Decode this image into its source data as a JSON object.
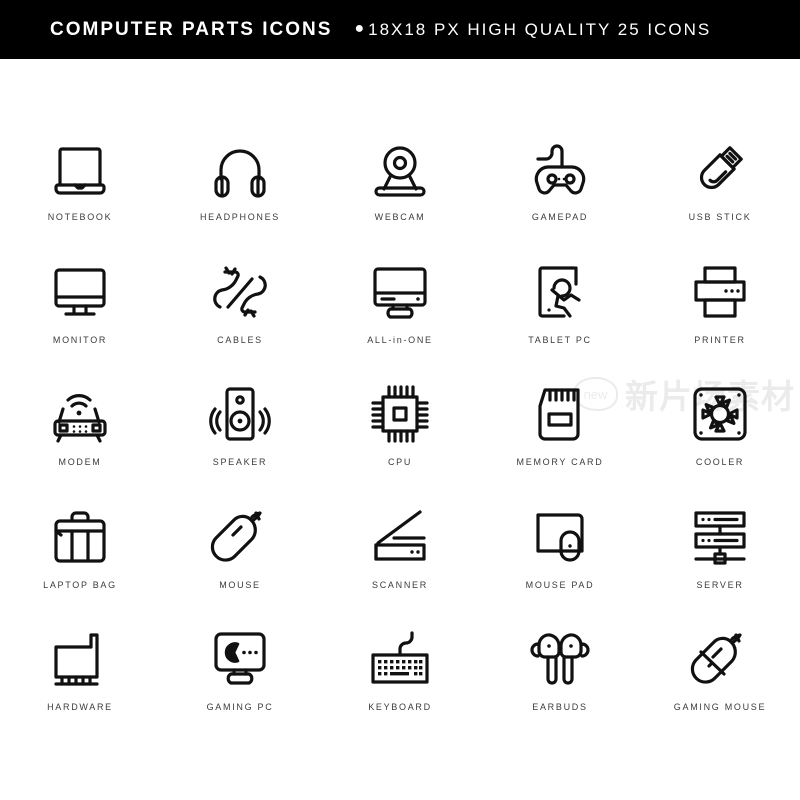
{
  "header": {
    "title": "COMPUTER PARTS ICONS",
    "bullet": "●",
    "subtitle": "18X18 PX HIGH QUALITY 25 ICONS",
    "background": "#000000",
    "text_color": "#ffffff"
  },
  "watermark": {
    "badge_text": "new",
    "chinese_text": "新片场素材",
    "color": "#777777"
  },
  "grid": {
    "columns": 5,
    "rows": 5,
    "icon_stroke_color": "#111111",
    "label_color": "#3b3b3b",
    "items": [
      {
        "label": "NOTEBOOK",
        "icon": "notebook-icon"
      },
      {
        "label": "HEADPHONES",
        "icon": "headphones-icon"
      },
      {
        "label": "WEBCAM",
        "icon": "webcam-icon"
      },
      {
        "label": "GAMEPAD",
        "icon": "gamepad-icon"
      },
      {
        "label": "USB STICK",
        "icon": "usb-stick-icon"
      },
      {
        "label": "MONITOR",
        "icon": "monitor-icon"
      },
      {
        "label": "CABLES",
        "icon": "cables-icon"
      },
      {
        "label": "ALL-in-ONE",
        "icon": "all-in-one-icon"
      },
      {
        "label": "TABLET PC",
        "icon": "tablet-pc-icon"
      },
      {
        "label": "PRINTER",
        "icon": "printer-icon"
      },
      {
        "label": "MODEM",
        "icon": "modem-icon"
      },
      {
        "label": "SPEAKER",
        "icon": "speaker-icon"
      },
      {
        "label": "CPU",
        "icon": "cpu-icon"
      },
      {
        "label": "MEMORY CARD",
        "icon": "memory-card-icon"
      },
      {
        "label": "COOLER",
        "icon": "cooler-icon"
      },
      {
        "label": "LAPTOP BAG",
        "icon": "laptop-bag-icon"
      },
      {
        "label": "MOUSE",
        "icon": "mouse-icon"
      },
      {
        "label": "SCANNER",
        "icon": "scanner-icon"
      },
      {
        "label": "MOUSE PAD",
        "icon": "mouse-pad-icon"
      },
      {
        "label": "SERVER",
        "icon": "server-icon"
      },
      {
        "label": "HARDWARE",
        "icon": "hardware-icon"
      },
      {
        "label": "GAMING PC",
        "icon": "gaming-pc-icon"
      },
      {
        "label": "KEYBOARD",
        "icon": "keyboard-icon"
      },
      {
        "label": "EARBUDS",
        "icon": "earbuds-icon"
      },
      {
        "label": "GAMING MOUSE",
        "icon": "gaming-mouse-icon"
      }
    ]
  }
}
